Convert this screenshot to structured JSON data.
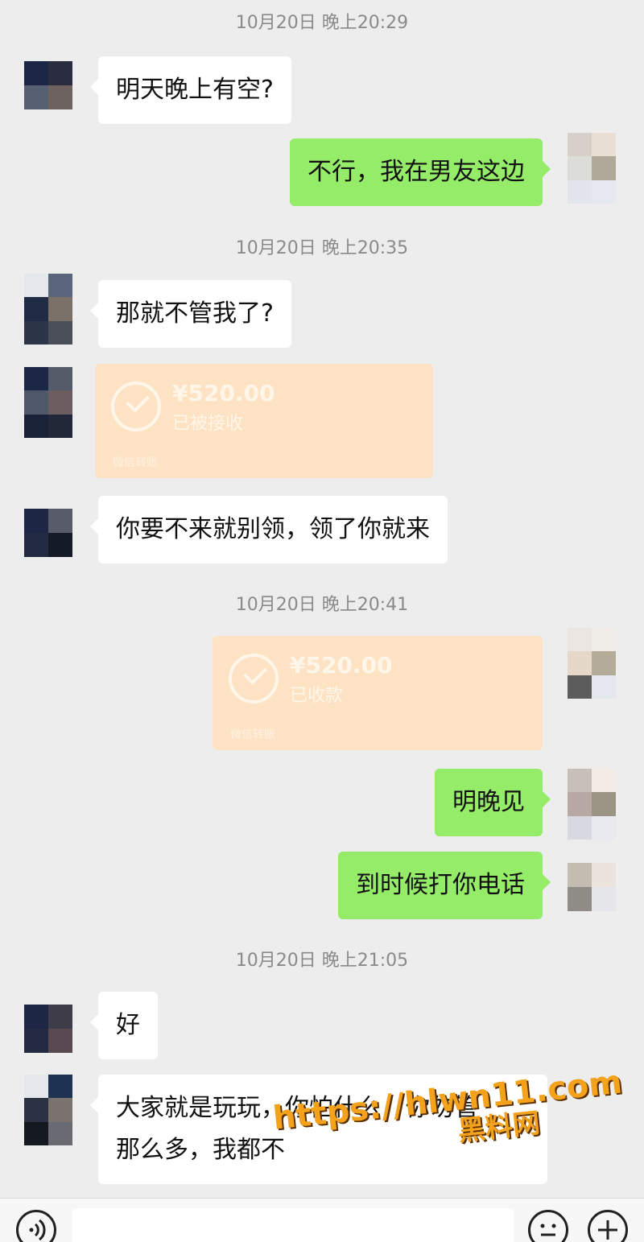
{
  "timestamps": [
    "10月20日 晚上20:29",
    "10月20日 晚上20:35",
    "10月20日 晚上20:41",
    "10月20日 晚上21:05"
  ],
  "messages": {
    "m1": "明天晚上有空?",
    "m2": "不行，我在男友这边",
    "m3": "那就不管我了?",
    "m4": "你要不来就别领，领了你就来",
    "m5": "明晚见",
    "m6": "到时候打你电话",
    "m7": "好",
    "m8_line1": "大家就是玩玩，你怕什么，你勿管",
    "m8_line2": "那么多，我都不"
  },
  "transfers": {
    "t1": {
      "amount": "¥520.00",
      "status": "已被接收",
      "source": "微信转账"
    },
    "t2": {
      "amount": "¥520.00",
      "status": "已收款",
      "source": "微信转账"
    }
  },
  "watermark": {
    "line1": "https://hlwn11.com",
    "line2": "黑料网"
  },
  "icons": {
    "voice": "voice-icon",
    "emoji": "emoji-icon",
    "plus": "plus-icon"
  },
  "colors": {
    "outgoing_bubble": "#95ec69",
    "incoming_bubble": "#ffffff",
    "transfer_card": "#fde3c4",
    "background": "#ededed"
  }
}
